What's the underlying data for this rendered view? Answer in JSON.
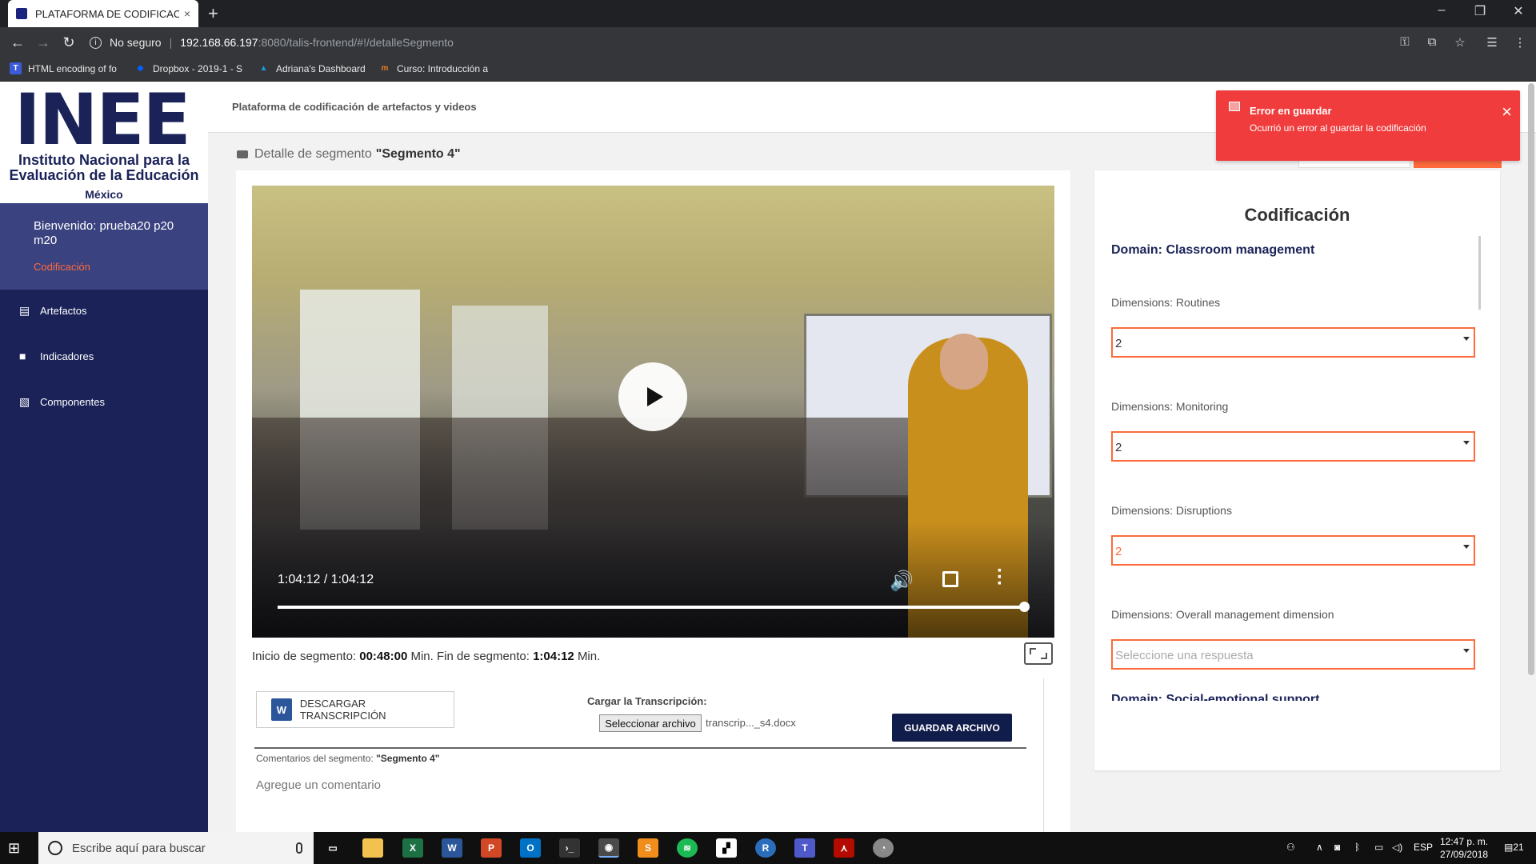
{
  "browser": {
    "tab_title": "PLATAFORMA DE CODIFICACIÓN",
    "tab_close": "×",
    "new_tab": "+",
    "security_label": "No seguro",
    "url_host": "192.168.66.197",
    "url_path": ":8080/talis-frontend/#!/detalleSegmento",
    "bookmarks": [
      {
        "label": "HTML encoding of fo",
        "icon": "T",
        "color": "#3b5bdb"
      },
      {
        "label": "Dropbox - 2019-1 - S",
        "icon": "◆",
        "color": "#0061ff"
      },
      {
        "label": "Adriana's Dashboard",
        "icon": "▲",
        "color": "#1a9cdc"
      },
      {
        "label": "Curso: Introducción a",
        "icon": "m",
        "color": "#e67e22"
      }
    ]
  },
  "sidebar": {
    "logo_mark": "INEE",
    "logo_line1": "Instituto Nacional para la",
    "logo_line2": "Evaluación de la Educación",
    "logo_line3": "México",
    "welcome": "Bienvenido: prueba20 p20 m20",
    "role": "Codificación",
    "items": [
      {
        "label": "Artefactos"
      },
      {
        "label": "Indicadores"
      },
      {
        "label": "Componentes"
      }
    ]
  },
  "header": {
    "title": "Plataforma de codificación de artefactos y videos"
  },
  "page": {
    "title_prefix": "Detalle de segmento",
    "title_segment": "\"Segmento 4\""
  },
  "video": {
    "time": "1:04:12 / 1:04:12",
    "progress": 1.0
  },
  "segment": {
    "start_label": "Inicio de segmento:",
    "start_value": "00:48:00",
    "min1": "Min.",
    "end_label": "Fin de segmento:",
    "end_value": "1:04:12",
    "min2": "Min."
  },
  "transcript": {
    "download_label": "DESCARGAR TRANSCRIPCIÓN",
    "word_icon": "W",
    "upload_label": "Cargar la Transcripción:",
    "file_button": "Seleccionar archivo",
    "file_name": "transcrip..._s4.docx",
    "save_button": "GUARDAR ARCHIVO"
  },
  "comments": {
    "label": "Comentarios del segmento:",
    "segment": "\"Segmento 4\"",
    "placeholder": "Agregue un comentario"
  },
  "coding": {
    "title": "Codificación",
    "domain1": "Domain: Classroom management",
    "dimensions": [
      {
        "label": "Dimensions: Routines",
        "value": "2"
      },
      {
        "label": "Dimensions: Monitoring",
        "value": "2"
      },
      {
        "label": "Dimensions: Disruptions",
        "value": "2"
      },
      {
        "label": "Dimensions: Overall management dimension",
        "value": "Seleccione una respuesta"
      }
    ],
    "domain2": "Domain: Social-emotional support"
  },
  "toast": {
    "title": "Error en guardar",
    "message": "Ocurrió un error al guardar la codificación",
    "close": "×"
  },
  "taskbar": {
    "search_placeholder": "Escribe aquí para buscar",
    "language": "ESP",
    "time": "12:47 p. m.",
    "date": "27/09/2018",
    "notifications": "21"
  },
  "colors": {
    "sidebar": "#1a2258",
    "accent": "#ff6a3d",
    "error": "#f03c3c",
    "primary_button": "#101d4a"
  }
}
